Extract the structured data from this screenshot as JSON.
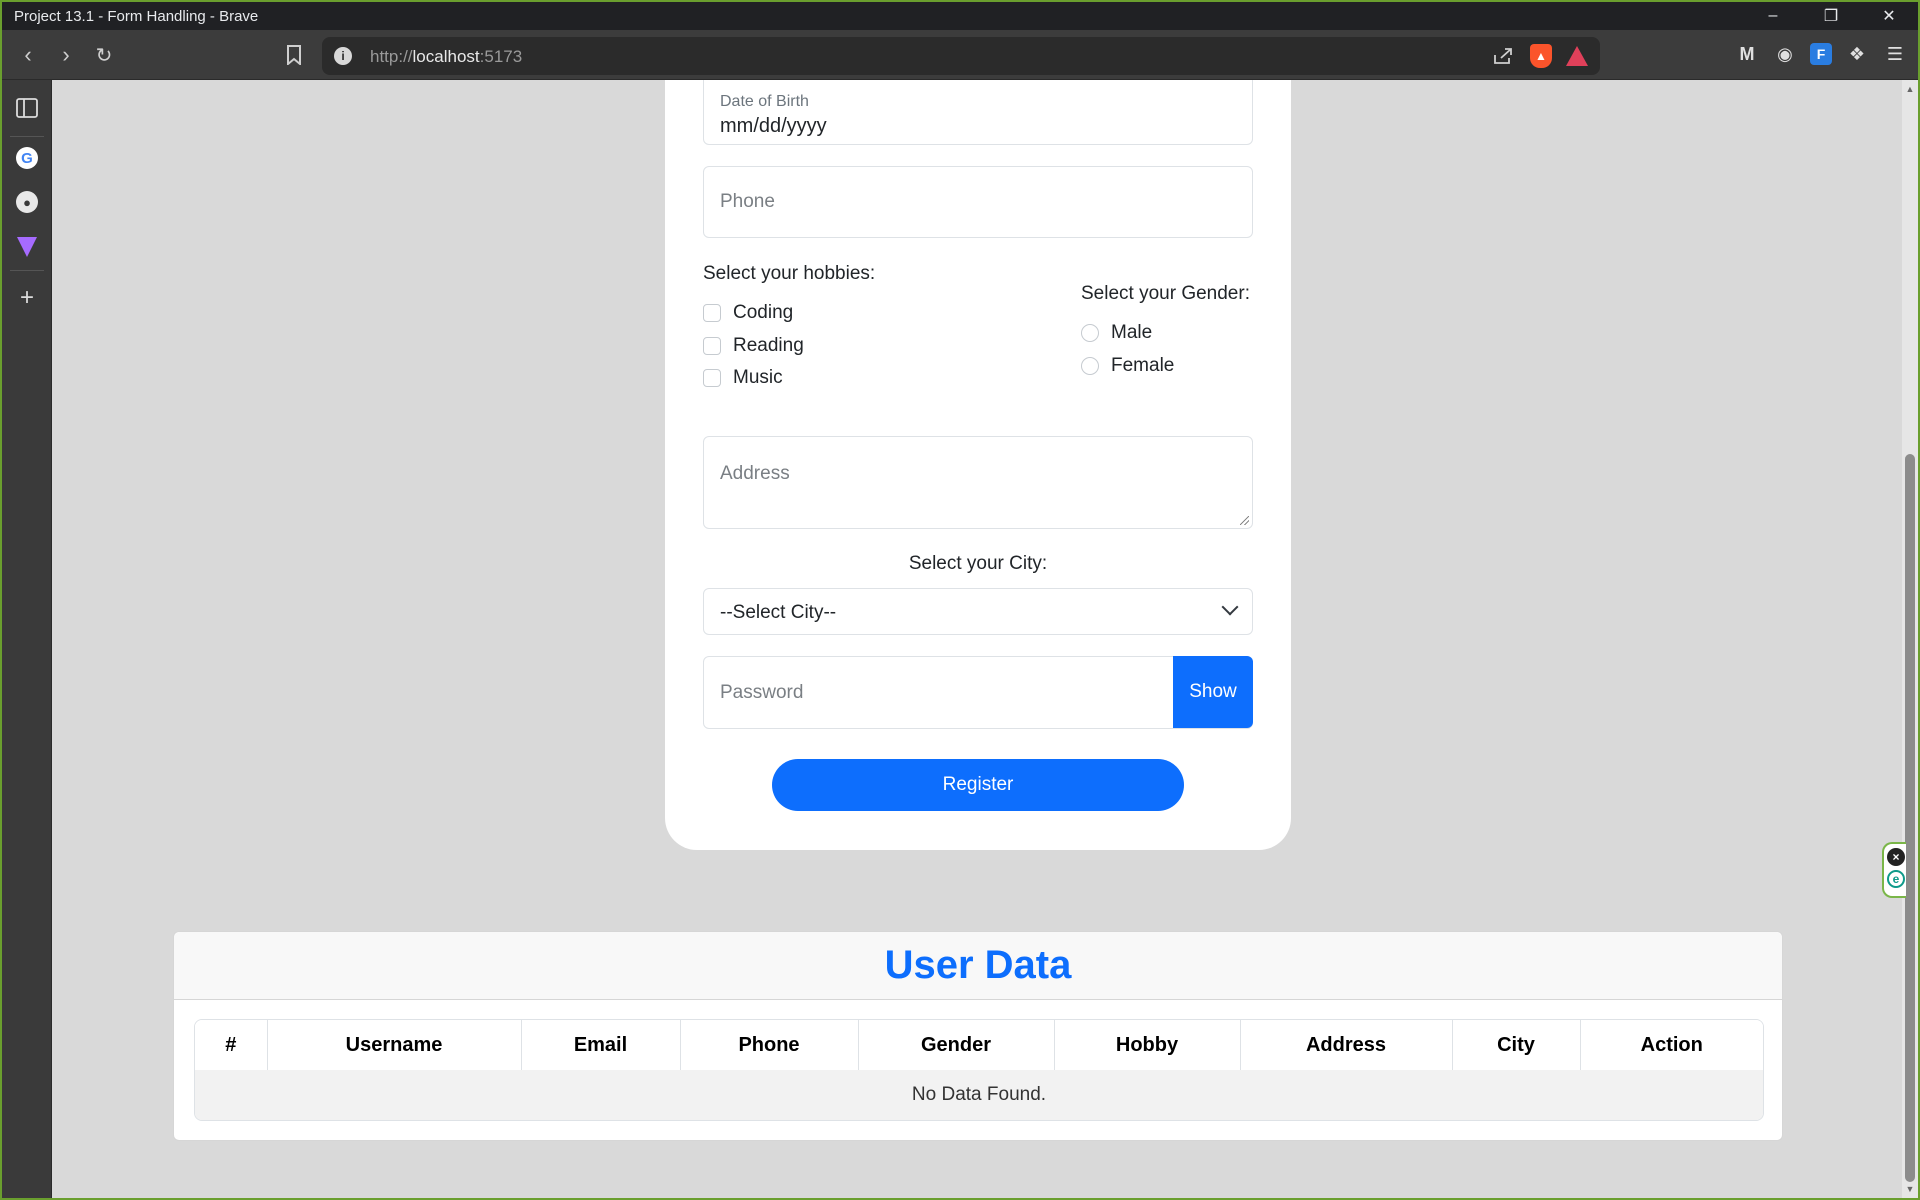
{
  "window": {
    "title": "Project 13.1 - Form Handling - Brave",
    "controls": {
      "minimize": "–",
      "restore": "❐",
      "close": "✕"
    }
  },
  "browser": {
    "url_scheme": "http://",
    "url_host": "localhost",
    "url_port": ":5173",
    "icons": [
      "back-icon",
      "forward-icon",
      "reload-icon",
      "bookmark-icon",
      "share-icon",
      "brave-shields-icon",
      "brave-rewards-icon",
      "malwarebytes-icon",
      "extension-icon",
      "ft-extension-icon",
      "extensions-puzzle-icon",
      "menu-icon"
    ]
  },
  "form": {
    "dob": {
      "label": "Date of Birth",
      "value": "mm/dd/yyyy"
    },
    "phone_placeholder": "Phone",
    "hobbies": {
      "title": "Select your hobbies:",
      "options": [
        "Coding",
        "Reading",
        "Music"
      ]
    },
    "gender": {
      "title": "Select your Gender:",
      "options": [
        "Male",
        "Female"
      ]
    },
    "address_placeholder": "Address",
    "city": {
      "title": "Select your City:",
      "selected": "--Select City--"
    },
    "password_placeholder": "Password",
    "show_label": "Show",
    "register_label": "Register"
  },
  "table": {
    "title": "User Data",
    "columns": [
      "#",
      "Username",
      "Email",
      "Phone",
      "Gender",
      "Hobby",
      "Address",
      "City",
      "Action"
    ],
    "empty_message": "No Data Found."
  },
  "colors": {
    "primary": "#0d6efd",
    "page_bg": "#d9d9d9",
    "card_bg": "#ffffff"
  }
}
